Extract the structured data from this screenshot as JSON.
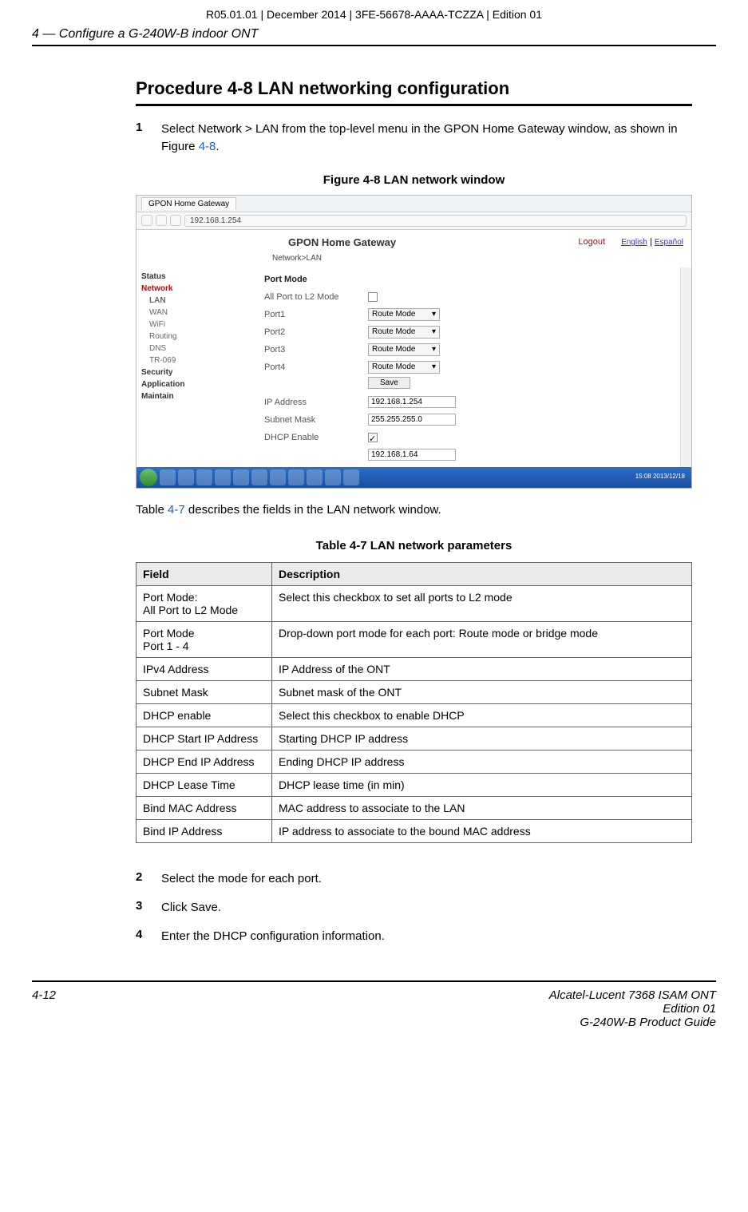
{
  "meta_top": "R05.01.01 | December 2014 | 3FE-56678-AAAA-TCZZA | Edition 01",
  "running_head": "4 —  Configure a G-240W-B indoor ONT",
  "proc_title": "Procedure 4-8  LAN networking configuration",
  "steps": {
    "s1_num": "1",
    "s1_a": "Select Network > LAN from the top-level menu in the GPON Home Gateway window, as shown in Figure ",
    "s1_ref": "4-8",
    "s1_b": ".",
    "s2_num": "2",
    "s2": "Select the mode for each port.",
    "s3_num": "3",
    "s3": "Click Save.",
    "s4_num": "4",
    "s4": "Enter the DHCP configuration information."
  },
  "fig_caption": "Figure 4-8  LAN network window",
  "below_fig_a": "Table ",
  "below_fig_ref": "4-7",
  "below_fig_b": " describes the fields in the LAN network window.",
  "tbl_caption": "Table 4-7 LAN network parameters",
  "tbl": {
    "h1": "Field",
    "h2": "Description",
    "r1f": "Port Mode:\nAll Port to L2 Mode",
    "r1d": "Select this checkbox to set all ports to L2 mode",
    "r2f": "Port Mode\nPort 1 - 4",
    "r2d": "Drop-down port mode for each port: Route mode or bridge mode",
    "r3f": "IPv4 Address",
    "r3d": "IP Address of the ONT",
    "r4f": "Subnet Mask",
    "r4d": "Subnet mask of the ONT",
    "r5f": "DHCP enable",
    "r5d": "Select this checkbox to enable DHCP",
    "r6f": "DHCP Start IP Address",
    "r6d": "Starting DHCP IP address",
    "r7f": "DHCP End IP Address",
    "r7d": "Ending DHCP IP address",
    "r8f": "DHCP Lease Time",
    "r8d": "DHCP lease time (in min)",
    "r9f": "Bind MAC Address",
    "r9d": "MAC address to associate to the LAN",
    "r10f": "Bind IP Address",
    "r10d": "IP address to associate to the bound MAC address"
  },
  "shot": {
    "tab": "GPON Home Gateway",
    "url": "192.168.1.254",
    "title": "GPON Home Gateway",
    "logout": "Logout",
    "lang1": "English",
    "lang2": "Español",
    "crumb": "Network>LAN",
    "side": {
      "status": "Status",
      "network": "Network",
      "lan": "LAN",
      "wan": "WAN",
      "wifi": "WiFi",
      "routing": "Routing",
      "dns": "DNS",
      "tr": "TR-069",
      "sec": "Security",
      "app": "Application",
      "maint": "Maintain"
    },
    "form": {
      "pm": "Port Mode",
      "alll2": "All Port to L2 Mode",
      "p1": "Port1",
      "p2": "Port2",
      "p3": "Port3",
      "p4": "Port4",
      "route": "Route Mode",
      "save": "Save",
      "ip_l": "IP Address",
      "ip_v": "192.168.1.254",
      "sm_l": "Subnet Mask",
      "sm_v": "255.255.255.0",
      "de_l": "DHCP Enable",
      "ds_v": "192.168.1.64"
    },
    "clock": "15:08\n2013/12/18"
  },
  "footer": {
    "left": "4-12",
    "r1": "Alcatel-Lucent 7368 ISAM ONT",
    "r2": "Edition 01",
    "r3": "G-240W-B Product Guide"
  }
}
